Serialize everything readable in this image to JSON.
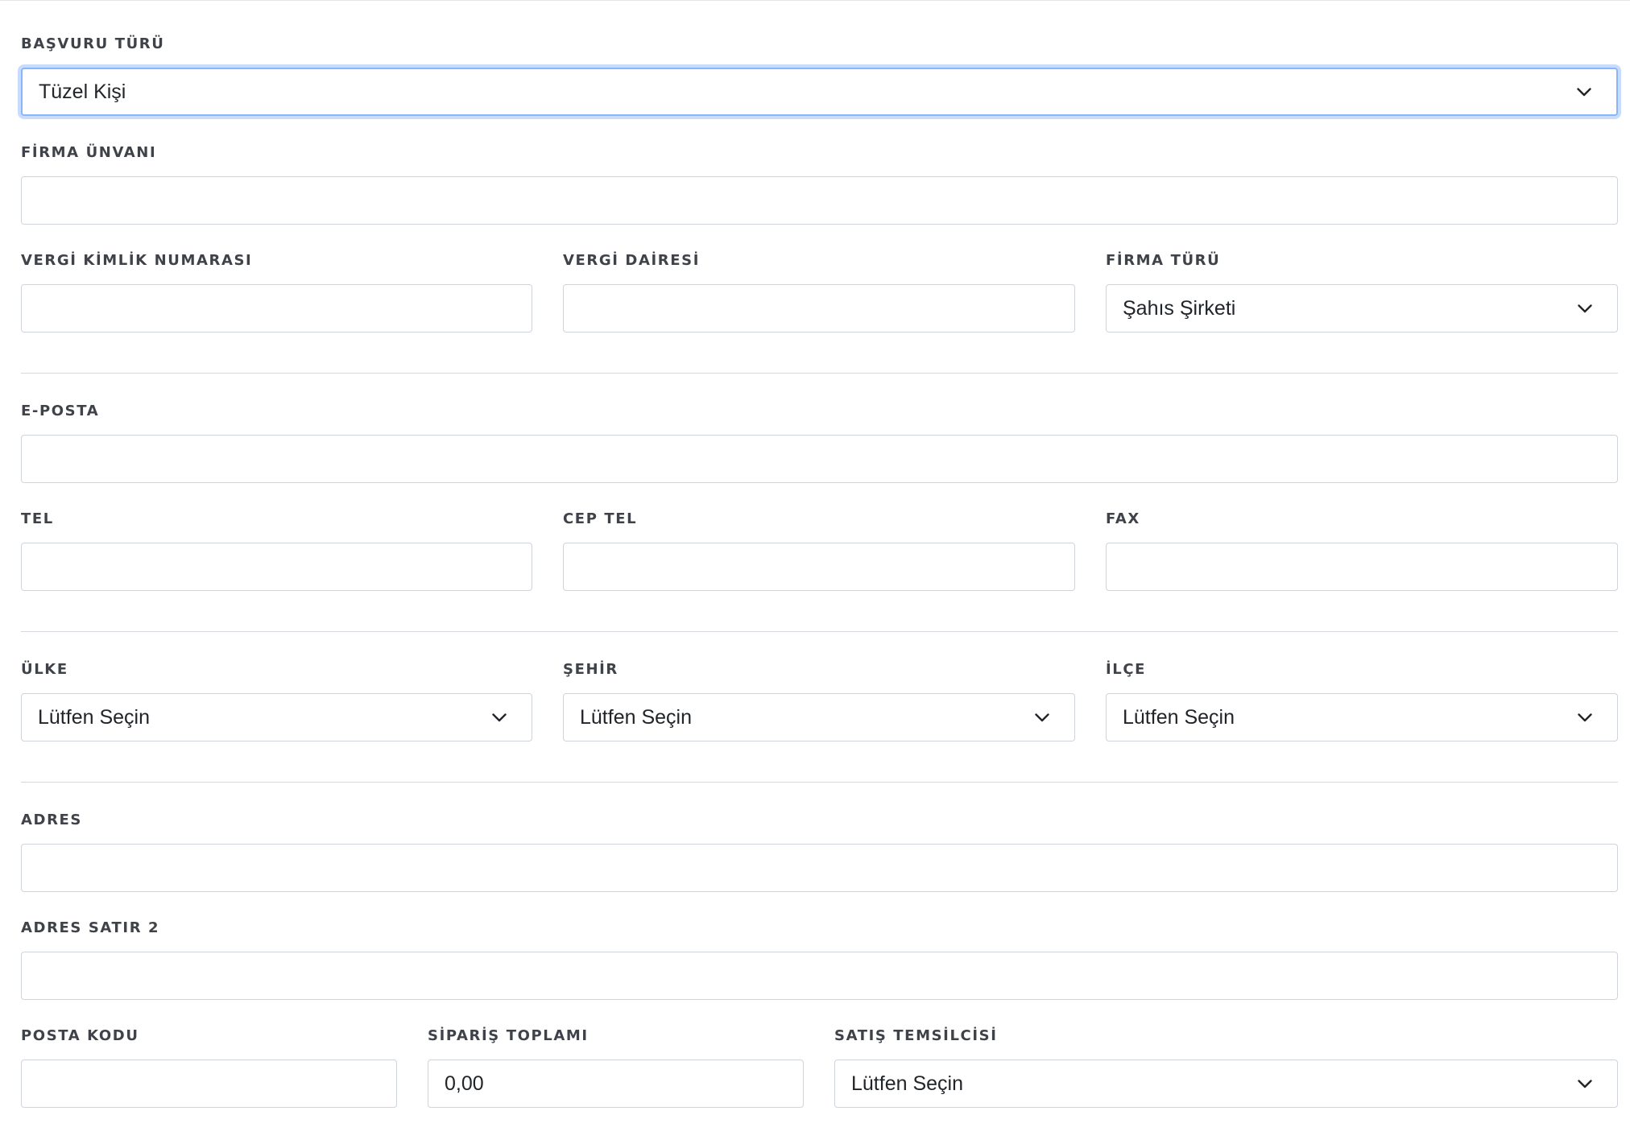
{
  "form": {
    "basvuru_turu": {
      "label": "BAŞVURU TÜRÜ",
      "value": "Tüzel Kişi",
      "icon": "chevron-down-icon"
    },
    "firma_unvani": {
      "label": "FİRMA ÜNVANI",
      "value": ""
    },
    "vergi_kimlik_numarasi": {
      "label": "VERGİ KİMLİK NUMARASI",
      "value": ""
    },
    "vergi_dairesi": {
      "label": "VERGİ DAİRESİ",
      "value": ""
    },
    "firma_turu": {
      "label": "FİRMA TÜRÜ",
      "value": "Şahıs Şirketi",
      "icon": "chevron-down-icon"
    },
    "eposta": {
      "label": "E-POSTA",
      "value": ""
    },
    "tel": {
      "label": "TEL",
      "value": ""
    },
    "cep_tel": {
      "label": "CEP TEL",
      "value": ""
    },
    "fax": {
      "label": "FAX",
      "value": ""
    },
    "ulke": {
      "label": "ÜLKE",
      "value": "Lütfen Seçin",
      "icon": "chevron-down-icon"
    },
    "sehir": {
      "label": "ŞEHİR",
      "value": "Lütfen Seçin",
      "icon": "chevron-down-icon"
    },
    "ilce": {
      "label": "İLÇE",
      "value": "Lütfen Seçin",
      "icon": "chevron-down-icon"
    },
    "adres": {
      "label": "ADRES",
      "value": ""
    },
    "adres_satir_2": {
      "label": "ADRES SATIR 2",
      "value": ""
    },
    "posta_kodu": {
      "label": "POSTA KODU",
      "value": ""
    },
    "siparis_toplami": {
      "label": "SİPARİŞ TOPLAMI",
      "value": "0,00"
    },
    "satis_temsilcisi": {
      "label": "SATIŞ TEMSİLCİSİ",
      "value": "Lütfen Seçin",
      "icon": "chevron-down-icon"
    }
  },
  "colors": {
    "label": "#3f4349",
    "border": "#ced4da",
    "focus_border": "#86b7fe",
    "divider": "#d5d8dc"
  }
}
